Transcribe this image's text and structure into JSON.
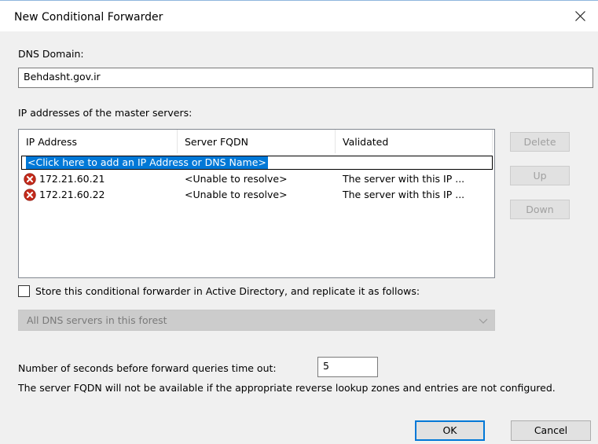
{
  "window": {
    "title": "New Conditional Forwarder",
    "close_icon": "close-icon"
  },
  "dns_domain": {
    "label": "DNS Domain:",
    "value": "Behdasht.gov.ir"
  },
  "master_servers": {
    "label": "IP addresses of the master servers:",
    "columns": [
      "IP Address",
      "Server FQDN",
      "Validated"
    ],
    "add_row_text": "<Click here to add an IP Address or DNS Name>",
    "rows": [
      {
        "status_icon": "error-icon",
        "ip": "172.21.60.21",
        "fqdn": "<Unable to resolve>",
        "validated": "The server with this IP ..."
      },
      {
        "status_icon": "error-icon",
        "ip": "172.21.60.22",
        "fqdn": "<Unable to resolve>",
        "validated": "The server with this IP ..."
      }
    ]
  },
  "side_buttons": {
    "delete": "Delete",
    "up": "Up",
    "down": "Down"
  },
  "store_ad": {
    "checkbox_label": "Store this conditional forwarder in Active Directory, and replicate it as follows:",
    "checked": false,
    "replication_value": "All DNS servers in this forest"
  },
  "timeout": {
    "label": "Number of seconds before forward queries time out:",
    "value": "5"
  },
  "note": "The server FQDN will not be available if the appropriate reverse lookup zones and entries are not configured.",
  "footer": {
    "ok": "OK",
    "cancel": "Cancel"
  },
  "colors": {
    "selection": "#0078d7",
    "error_icon": "#c42b1c",
    "dialog_bg": "#f0f0f0"
  }
}
